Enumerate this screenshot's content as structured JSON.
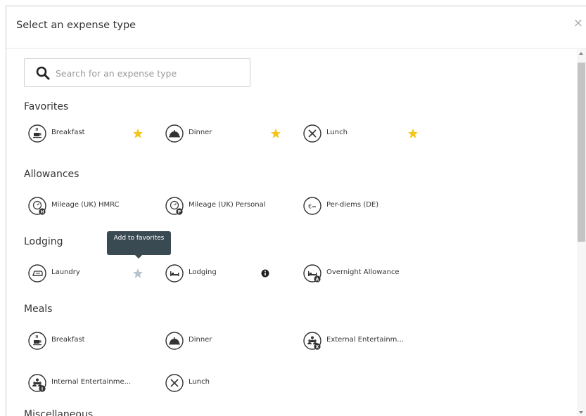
{
  "modal": {
    "title": "Select an expense type",
    "close_label": "×"
  },
  "search": {
    "placeholder": "Search for an expense type",
    "value": ""
  },
  "sections": {
    "favorites": {
      "title": "Favorites",
      "items": [
        {
          "label": "Breakfast",
          "icon": "breakfast-icon",
          "favorite": true
        },
        {
          "label": "Dinner",
          "icon": "dinner-icon",
          "favorite": true
        },
        {
          "label": "Lunch",
          "icon": "lunch-icon",
          "favorite": true
        }
      ]
    },
    "allowances": {
      "title": "Allowances",
      "items": [
        {
          "label": "Mileage (UK) HMRC",
          "icon": "mileage-icon",
          "badge": "H"
        },
        {
          "label": "Mileage (UK) Personal",
          "icon": "mileage-icon",
          "badge": "P"
        },
        {
          "label": "Per-diems (DE)",
          "icon": "per-diem-icon"
        }
      ]
    },
    "lodging": {
      "title": "Lodging",
      "items": [
        {
          "label": "Laundry",
          "icon": "laundry-icon",
          "favorite": false
        },
        {
          "label": "Lodging",
          "icon": "bed-icon",
          "info": true
        },
        {
          "label": "Overnight Allowance",
          "icon": "bed-icon",
          "badge": "A"
        }
      ]
    },
    "meals": {
      "title": "Meals",
      "items": [
        {
          "label": "Breakfast",
          "icon": "breakfast-icon"
        },
        {
          "label": "Dinner",
          "icon": "dinner-icon"
        },
        {
          "label": "External Entertainm...",
          "icon": "entertainment-icon",
          "badge": "X"
        },
        {
          "label": "Internal Entertainme...",
          "icon": "entertainment-icon",
          "badge": "I"
        },
        {
          "label": "Lunch",
          "icon": "lunch-icon"
        }
      ]
    },
    "miscellaneous": {
      "title": "Miscellaneous"
    }
  },
  "tooltip": {
    "text": "Add to favorites"
  },
  "colors": {
    "star_active": "#f5c518",
    "star_inactive": "#b7c3cc",
    "tooltip_bg": "#3a4a53",
    "icon_stroke": "#333333"
  }
}
